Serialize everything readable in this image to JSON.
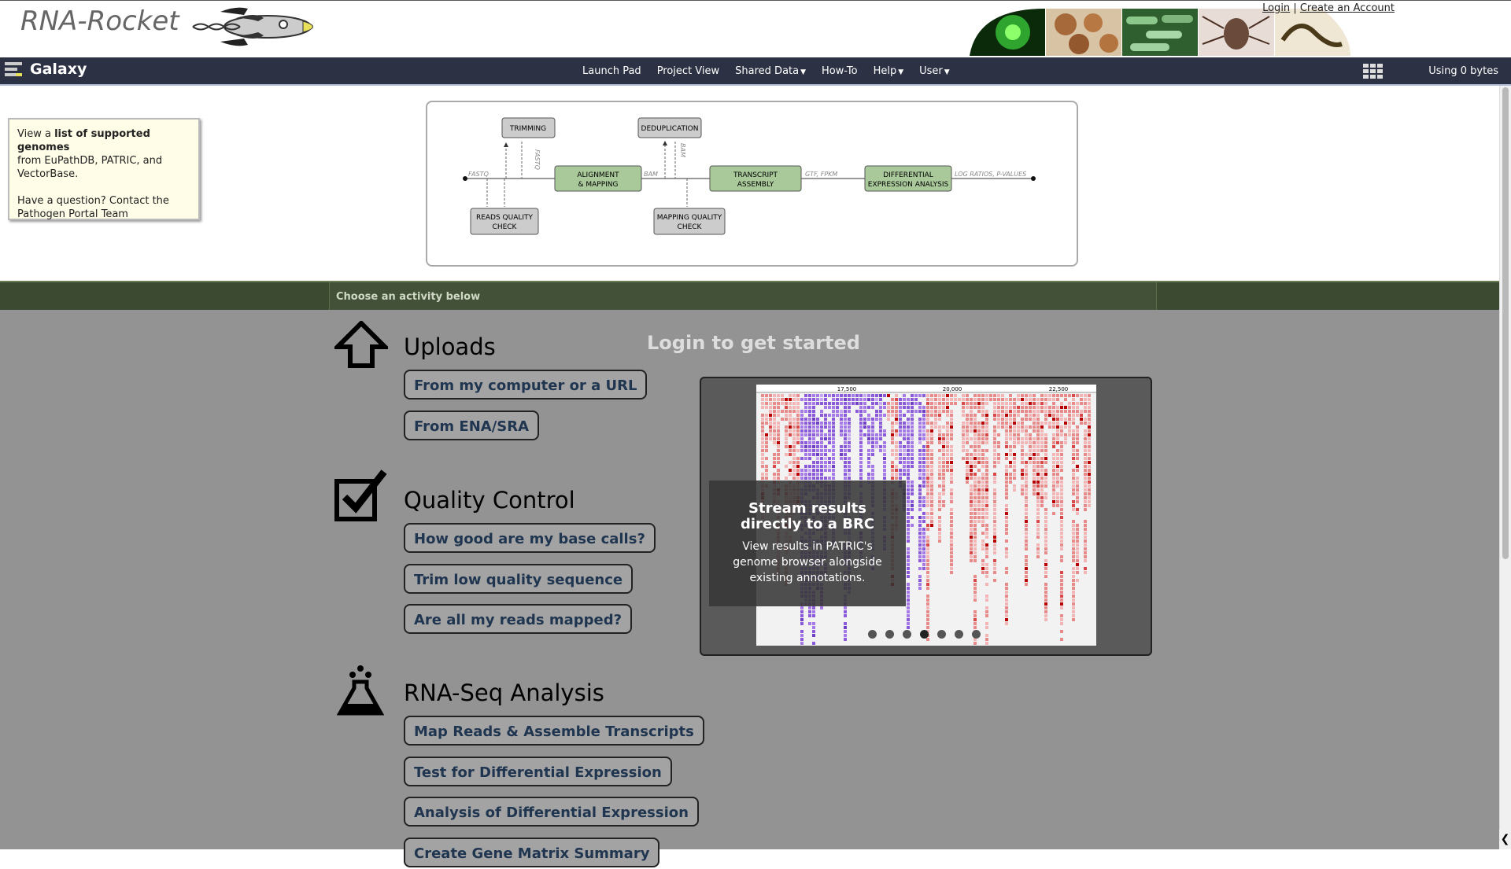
{
  "header": {
    "logo_text": "RNA-Rocket",
    "auth": {
      "login": "Login",
      "separator": "|",
      "create_account": "Create an Account"
    }
  },
  "galaxy_bar": {
    "brand": "Galaxy",
    "nav": [
      {
        "label": "Launch Pad"
      },
      {
        "label": "Project View"
      },
      {
        "label": "Shared Data"
      },
      {
        "label": "How-To"
      },
      {
        "label": "Help"
      },
      {
        "label": "User"
      }
    ],
    "usage": "Using 0 bytes"
  },
  "notice": {
    "view_a": "View a",
    "genomes_link": "list of supported genomes",
    "from": "from",
    "eupathdb": "EuPathDB",
    "comma": ",",
    "patric": "PATRIC",
    "and": ", and",
    "vectorbase": "VectorBase",
    "period": ".",
    "question": "Have a question?",
    "contact_link": "Contact the Pathogen Portal Team"
  },
  "diagram": {
    "boxes": {
      "trimming": "TRIMMING",
      "deduplication": "DEDUPLICATION",
      "alignment_1": "ALIGNMENT",
      "alignment_2": "& MAPPING",
      "assembly_1": "TRANSCRIPT",
      "assembly_2": "ASSEMBLY",
      "diff_1": "DIFFERENTIAL",
      "diff_2": "EXPRESSION ANALYSIS",
      "reads_qc_1": "READS QUALITY",
      "reads_qc_2": "CHECK",
      "map_qc_1": "MAPPING QUALITY",
      "map_qc_2": "CHECK"
    },
    "edge_labels": {
      "fastq_in": "FASTQ",
      "fastq_trim": "FASTQ",
      "bam": "BAM",
      "bam_dedup": "BAM",
      "gtf": "GTF, FPKM",
      "logratios": "LOG RATIOS, P-VALUES"
    }
  },
  "activity": {
    "label": "Choose an activity below",
    "login_message": "Login to get started"
  },
  "sections": [
    {
      "title": "Uploads",
      "icon": "upload-arrow-icon",
      "buttons": [
        "From my computer or a URL",
        "From ENA/SRA"
      ]
    },
    {
      "title": "Quality Control",
      "icon": "checkbox-icon",
      "buttons": [
        "How good are my base calls?",
        "Trim low quality sequence",
        "Are all my reads mapped?"
      ]
    },
    {
      "title": "RNA-Seq Analysis",
      "icon": "flask-icon",
      "buttons": [
        "Map Reads & Assemble Transcripts",
        "Test for Differential Expression",
        "Analysis of Differential Expression",
        "Create Gene Matrix Summary"
      ]
    }
  ],
  "carousel": {
    "axis_ticks": [
      "17,500",
      "20,000",
      "22,500"
    ],
    "caption_title": "Stream results directly to a BRC",
    "caption_text": "View results in PATRIC's genome browser alongside existing annotations.",
    "slide_count": 7,
    "active_slide": 4
  },
  "colors": {
    "galaxy_bar": "#2c3143",
    "activity_bar": "#3c4a32",
    "main_bg": "#939393",
    "button_text": "#1f3550",
    "notice_bg": "#fffde7"
  }
}
